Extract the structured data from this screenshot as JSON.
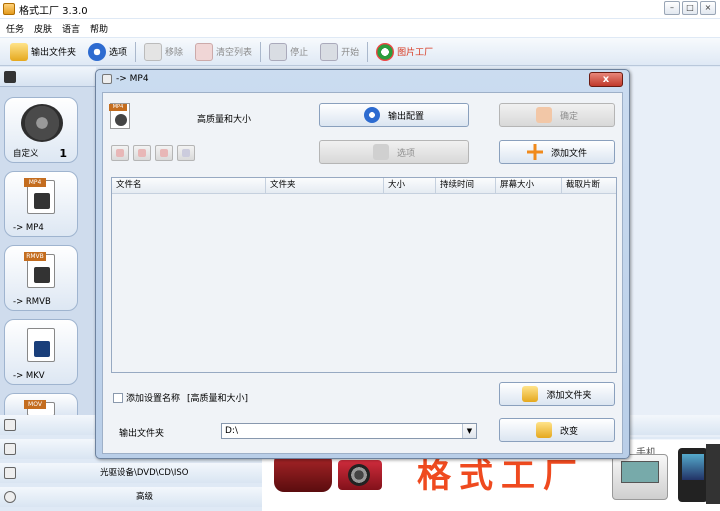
{
  "window": {
    "title": "格式工厂 3.3.0"
  },
  "menu": [
    "任务",
    "皮肤",
    "语言",
    "帮助"
  ],
  "toolbar": {
    "output_folder": "输出文件夹",
    "options": "选项",
    "remove": "移除",
    "clear_list": "清空列表",
    "stop": "停止",
    "start": "开始",
    "picture_factory": "图片工厂"
  },
  "sidebar": {
    "items": [
      {
        "label": "自定义",
        "count": "1"
      },
      {
        "label": "-> MP4",
        "tag": "MP4"
      },
      {
        "label": "-> RMVB",
        "tag": "RMVB"
      },
      {
        "label": "-> MKV",
        "tag": ""
      },
      {
        "label": "",
        "tag": "MOV"
      }
    ]
  },
  "bottom": {
    "device_text": "光驱设备\\DVD\\CD\\ISO",
    "advanced": "高级",
    "brand": "格式工厂",
    "hd": "HD",
    "mobile": "手机"
  },
  "dialog": {
    "title": "-> MP4",
    "close": "x",
    "quality": "高质量和大小",
    "output_config": "输出配置",
    "ok": "确定",
    "options": "选项",
    "add_file": "添加文件",
    "columns": [
      "文件名",
      "文件夹",
      "大小",
      "持续时间",
      "屏幕大小",
      "截取片断"
    ],
    "add_setting_name": "添加设置名称",
    "setting_value": "[高质量和大小]",
    "output_folder_label": "输出文件夹",
    "output_folder_value": "D:\\",
    "add_folder": "添加文件夹",
    "change": "改变"
  },
  "colors": {
    "brand": "#ef4a1f",
    "accent": "#2d6bd0"
  }
}
